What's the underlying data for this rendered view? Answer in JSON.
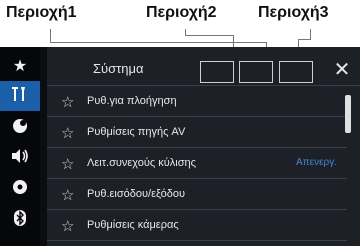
{
  "callouts": [
    "Περιοχή1",
    "Περιοχή2",
    "Περιοχή3"
  ],
  "header": {
    "title": "Σύστημα"
  },
  "icons": {
    "favorites": "star-icon",
    "system": "settings-tools-icon",
    "av": "av-source-icon",
    "sound": "speaker-volume-icon",
    "disc": "disc-icon",
    "bluetooth": "bluetooth-icon",
    "close": "close-icon"
  },
  "nav": {
    "active": "system"
  },
  "menu": [
    {
      "label": "Ρυθ.για πλοήγηση",
      "value": ""
    },
    {
      "label": "Ρυθμίσεις πηγής AV",
      "value": ""
    },
    {
      "label": "Λειτ.συνεχούς κύλισης",
      "value": "Απενεργ."
    },
    {
      "label": "Ρυθ.εισόδου/εξόδου",
      "value": ""
    },
    {
      "label": "Ρυθμίσεις κάμερας",
      "value": ""
    }
  ],
  "colors": {
    "accent": "#1a5fa8",
    "value_text": "#3f86d6"
  }
}
